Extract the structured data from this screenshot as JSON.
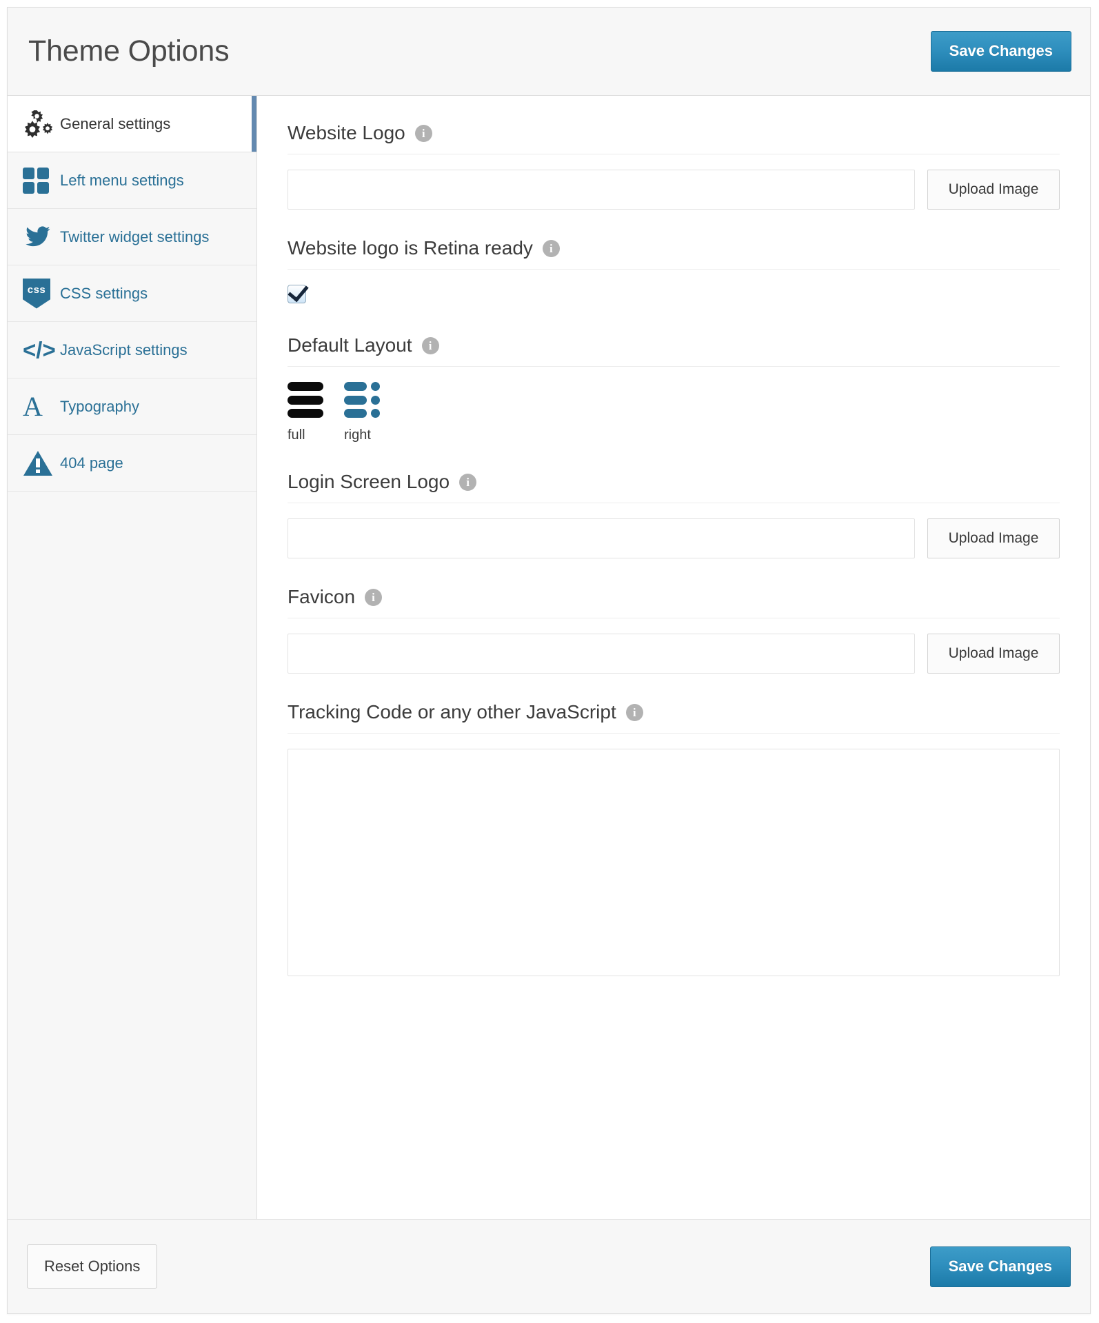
{
  "header": {
    "title": "Theme Options",
    "save_label": "Save Changes"
  },
  "sidebar": {
    "items": [
      {
        "label": "General settings",
        "icon": "gears-icon",
        "active": true
      },
      {
        "label": "Left menu settings",
        "icon": "grid-icon",
        "active": false
      },
      {
        "label": "Twitter widget settings",
        "icon": "twitter-bird-icon",
        "active": false
      },
      {
        "label": "CSS settings",
        "icon": "css-shield-icon",
        "active": false
      },
      {
        "label": "JavaScript settings",
        "icon": "code-brackets-icon",
        "active": false
      },
      {
        "label": "Typography",
        "icon": "letter-a-icon",
        "active": false
      },
      {
        "label": "404 page",
        "icon": "warning-triangle-icon",
        "active": false
      }
    ],
    "css_icon_text": "css",
    "code_icon_text": "</>",
    "typography_icon_text": "A"
  },
  "main": {
    "website_logo": {
      "title": "Website Logo",
      "info": "i",
      "value": "",
      "placeholder": "",
      "upload_label": "Upload Image"
    },
    "retina": {
      "title": "Website logo is Retina ready",
      "info": "i",
      "checked": true
    },
    "default_layout": {
      "title": "Default Layout",
      "info": "i",
      "options": [
        {
          "label": "full",
          "selected": true
        },
        {
          "label": "right",
          "selected": false
        }
      ]
    },
    "login_logo": {
      "title": "Login Screen Logo",
      "info": "i",
      "value": "",
      "placeholder": "",
      "upload_label": "Upload Image"
    },
    "favicon": {
      "title": "Favicon",
      "info": "i",
      "value": "",
      "placeholder": "",
      "upload_label": "Upload Image"
    },
    "tracking": {
      "title": "Tracking Code or any other JavaScript",
      "info": "i",
      "value": "",
      "placeholder": ""
    }
  },
  "footer": {
    "reset_label": "Reset Options",
    "save_label": "Save Changes"
  },
  "colors": {
    "accent": "#2a7096",
    "primary_button": "#2f8fbe",
    "active_marker": "#6389b0",
    "info_icon": "#b2b2b2",
    "panel_bg": "#f7f7f7"
  }
}
